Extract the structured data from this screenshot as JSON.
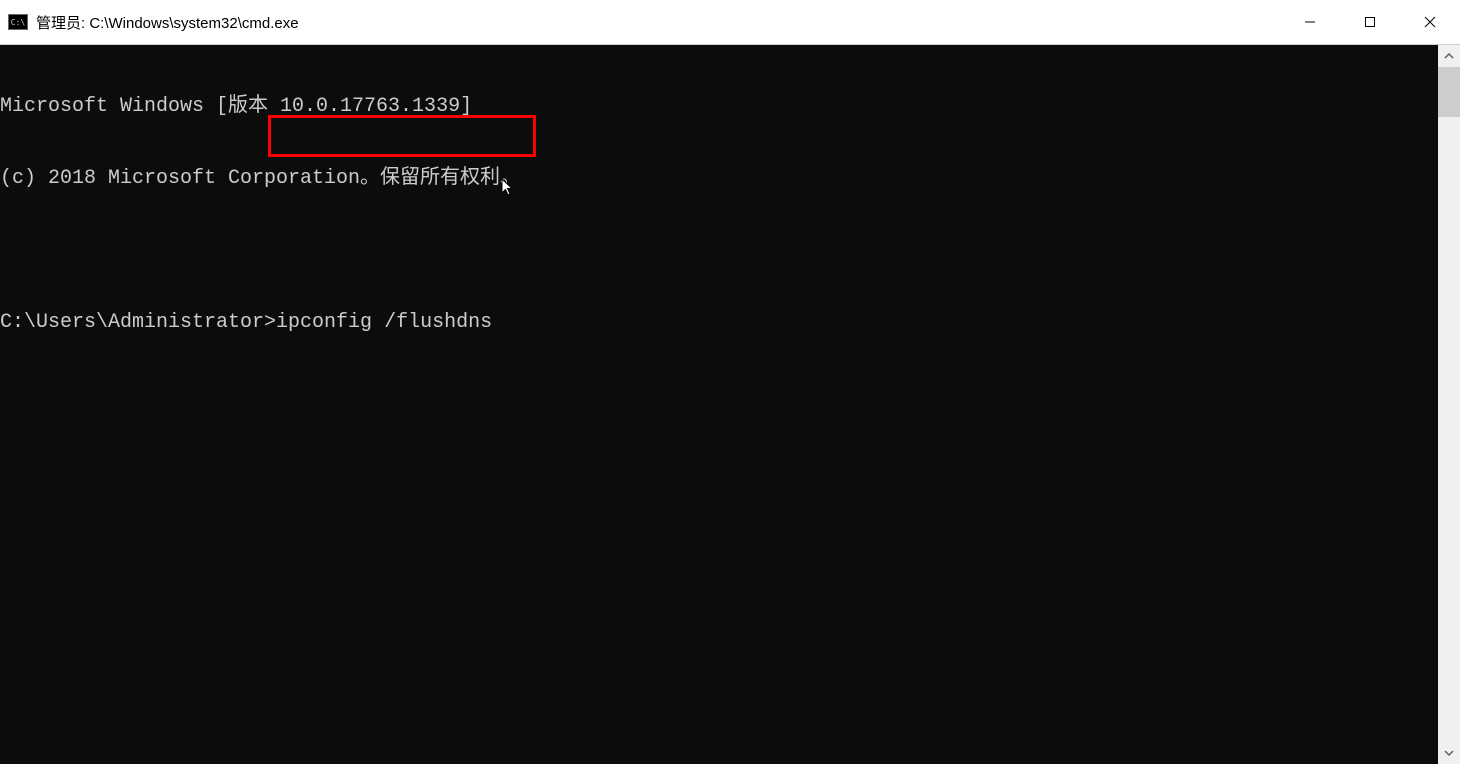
{
  "titlebar": {
    "icon_label": "C:\\",
    "title": "管理员: C:\\Windows\\system32\\cmd.exe"
  },
  "terminal": {
    "line1": "Microsoft Windows [版本 10.0.17763.1339]",
    "line2": "(c) 2018 Microsoft Corporation。保留所有权利。",
    "prompt": "C:\\Users\\Administrator>",
    "command": "ipconfig /flushdns"
  },
  "colors": {
    "highlight": "#ff0000",
    "terminal_bg": "#0c0c0c",
    "terminal_fg": "#cccccc"
  }
}
